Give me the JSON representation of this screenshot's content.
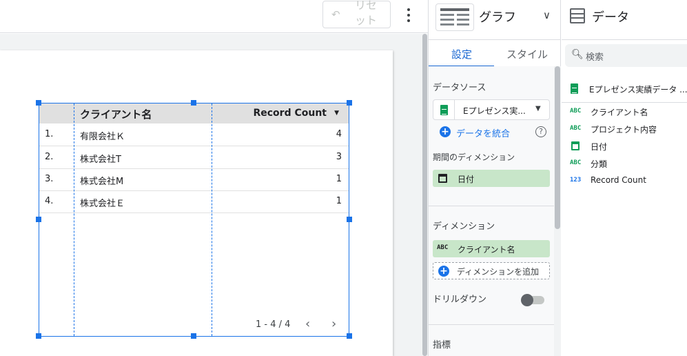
{
  "toolbar": {
    "reset_label": "リセット",
    "undo_icon": "undo-icon",
    "more_icon": "more-vert-icon"
  },
  "table": {
    "headers": {
      "client": "クライアント名",
      "count": "Record Count"
    },
    "rows": [
      {
        "idx": "1.",
        "name": "有限会社Ｋ",
        "count": "4"
      },
      {
        "idx": "2.",
        "name": "株式会社T",
        "count": "3"
      },
      {
        "idx": "3.",
        "name": "株式会社M",
        "count": "1"
      },
      {
        "idx": "4.",
        "name": "株式会社Ｅ",
        "count": "1"
      }
    ],
    "pagination": "1 - 4 / 4",
    "prev_icon": "‹",
    "next_icon": "›"
  },
  "properties": {
    "chart_type": "グラフ",
    "tabs": {
      "setup": "設定",
      "style": "スタイル"
    },
    "data_source_title": "データソース",
    "data_source_name": "Eプレゼンス実...",
    "blend_label": "データを統合",
    "date_range_title": "期間のディメンション",
    "date_range_value": "日付",
    "dimension_title": "ディメンション",
    "dimension_value": "クライアント名",
    "add_dimension": "ディメンションを追加",
    "drilldown_label": "ドリルダウン",
    "metric_title": "指標",
    "drilldown_enabled": false
  },
  "data_panel": {
    "title": "データ",
    "search_placeholder": "検索",
    "data_source": "Eプレゼンス実績データ ...",
    "fields": [
      {
        "type": "ABC",
        "name": "クライアント名"
      },
      {
        "type": "ABC",
        "name": "プロジェクト内容"
      },
      {
        "type": "date",
        "name": "日付"
      },
      {
        "type": "ABC",
        "name": "分類"
      },
      {
        "type": "123",
        "name": "Record Count"
      }
    ]
  },
  "colors": {
    "accent": "#1a73e8",
    "chip": "#c8e6c9",
    "sheets": "#0f9d58"
  }
}
